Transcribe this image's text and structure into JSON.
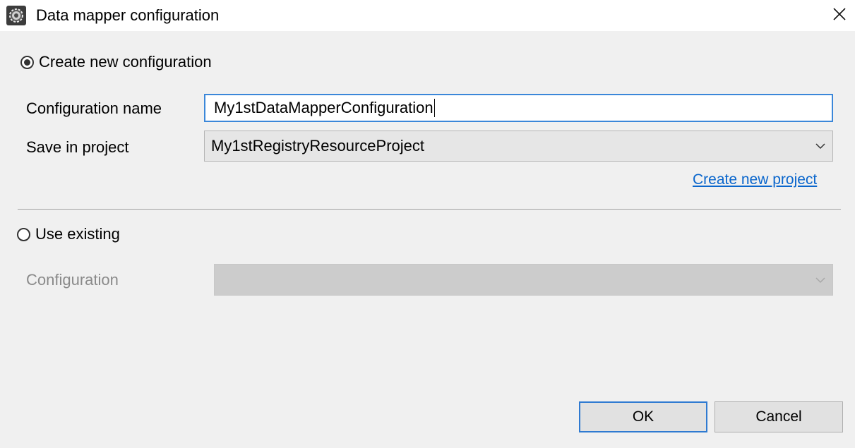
{
  "window": {
    "title": "Data mapper configuration",
    "icon": "gear-icon",
    "close_icon": "close-icon"
  },
  "create_new": {
    "radio_label": "Create new configuration",
    "selected": true,
    "config_name_label": "Configuration name",
    "config_name_value": "My1stDataMapperConfiguration",
    "save_in_label": "Save in project",
    "save_in_value": "My1stRegistryResourceProject",
    "create_project_link": "Create new project"
  },
  "use_existing": {
    "radio_label": "Use existing",
    "selected": false,
    "config_label": "Configuration",
    "config_value": ""
  },
  "buttons": {
    "ok": "OK",
    "cancel": "Cancel"
  },
  "colors": {
    "accent": "#2f7ad1",
    "link": "#0a66cc",
    "dialog_bg": "#f0f0f0"
  }
}
